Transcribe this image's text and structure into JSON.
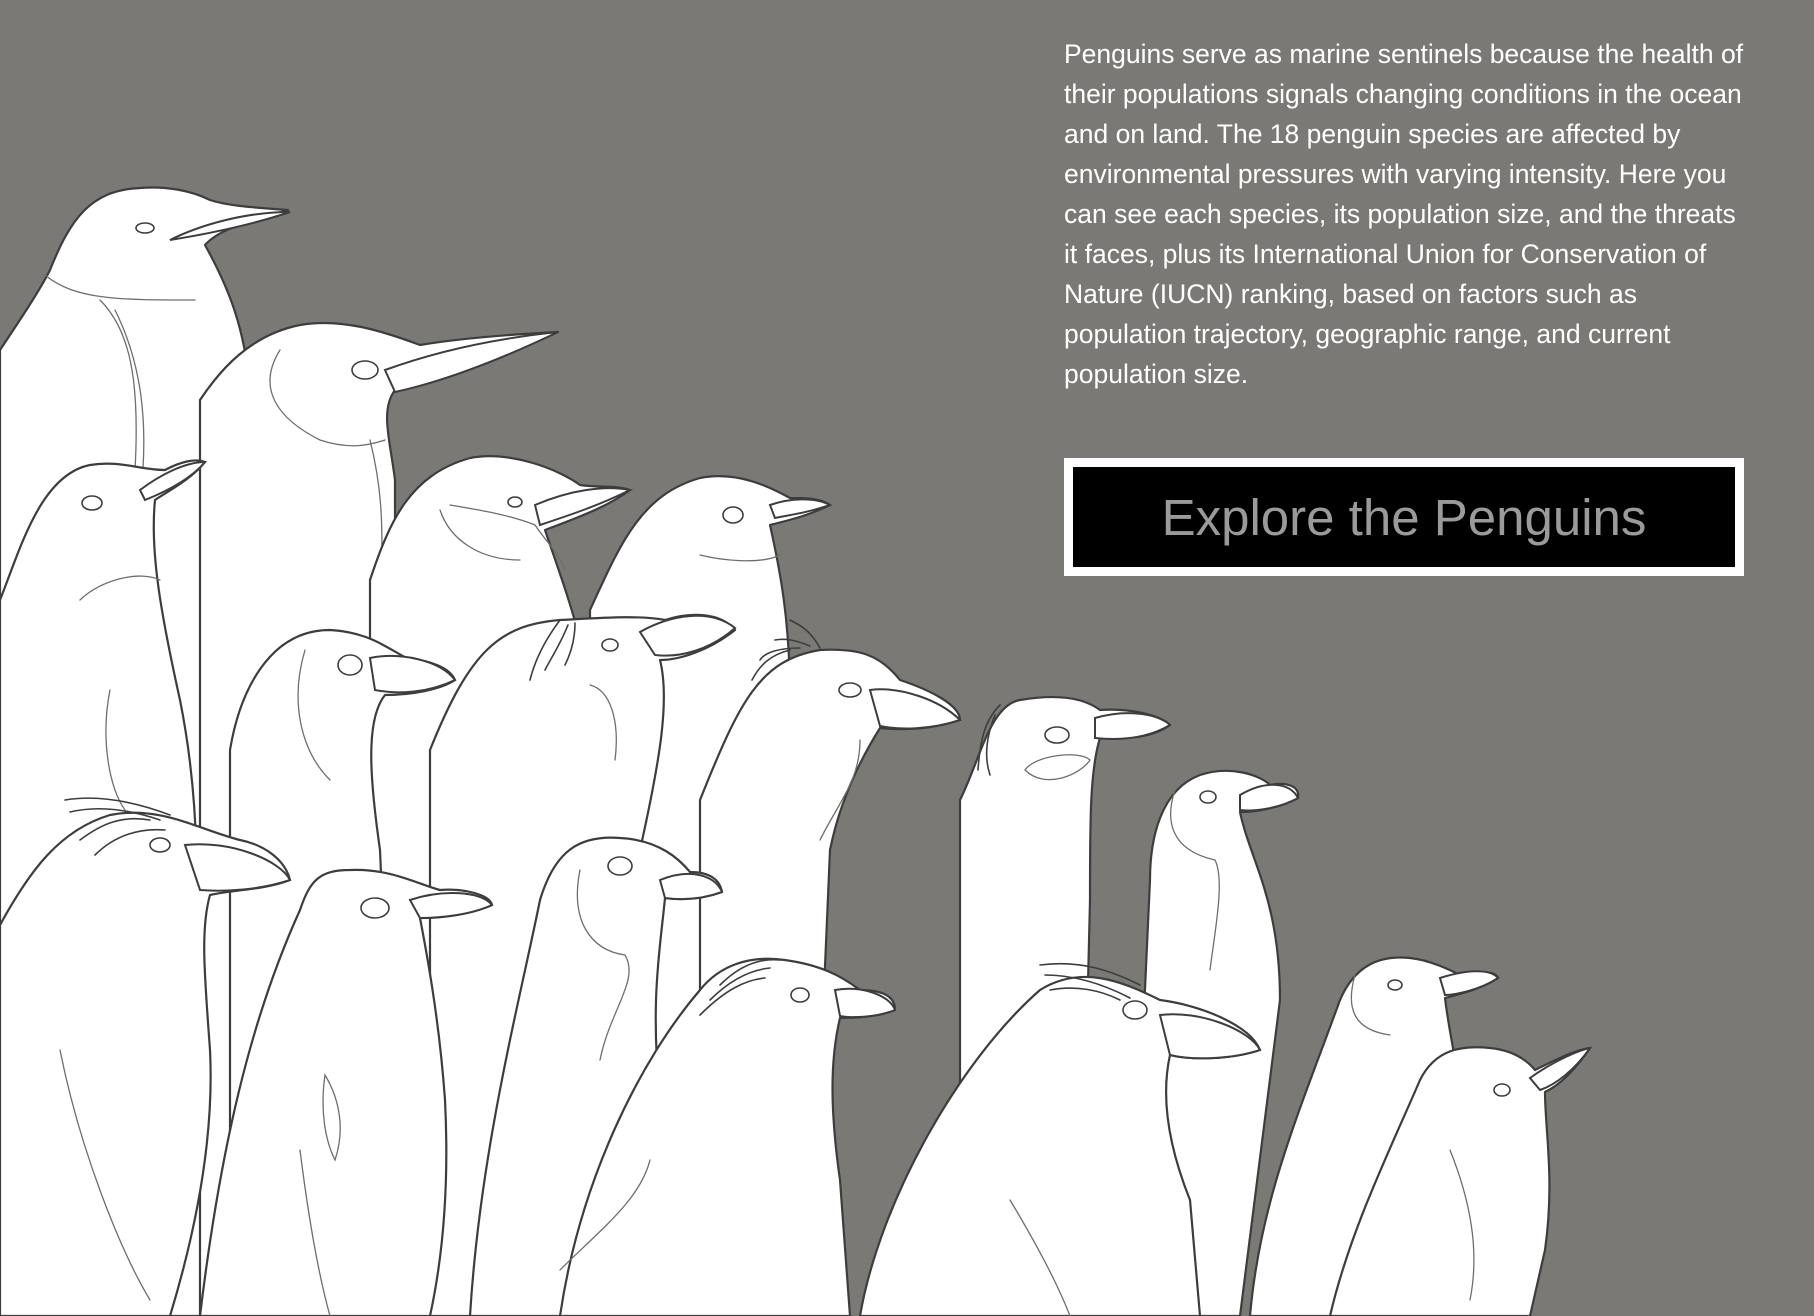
{
  "colors": {
    "background": "#7a7975",
    "text": "#ffffff",
    "button_bg": "#000000",
    "button_border": "#ffffff",
    "button_text": "#9a9a9a",
    "outline": "#3d3d3d"
  },
  "intro": {
    "text": "Penguins serve as marine sentinels because the health of their populations signals changing conditions in the ocean and on land. The 18 penguin species are affected by environmental pressures with varying intensity. Here you can see each species, its population size, and the threats it faces, plus its International Union for Conservation of Nature (IUCN) ranking, based on factors such as population trajectory, geographic range, and current population size."
  },
  "cta": {
    "label": "Explore the Penguins"
  },
  "illustration": {
    "icon": "penguin-group-illustration"
  }
}
